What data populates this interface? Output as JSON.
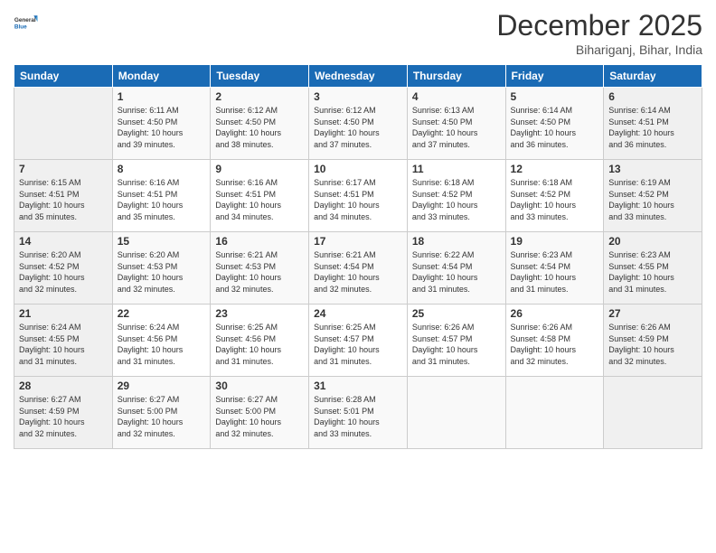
{
  "logo": {
    "line1": "General",
    "line2": "Blue"
  },
  "title": "December 2025",
  "subtitle": "Bihariganj, Bihar, India",
  "weekdays": [
    "Sunday",
    "Monday",
    "Tuesday",
    "Wednesday",
    "Thursday",
    "Friday",
    "Saturday"
  ],
  "weeks": [
    [
      {
        "day": "",
        "info": ""
      },
      {
        "day": "1",
        "info": "Sunrise: 6:11 AM\nSunset: 4:50 PM\nDaylight: 10 hours\nand 39 minutes."
      },
      {
        "day": "2",
        "info": "Sunrise: 6:12 AM\nSunset: 4:50 PM\nDaylight: 10 hours\nand 38 minutes."
      },
      {
        "day": "3",
        "info": "Sunrise: 6:12 AM\nSunset: 4:50 PM\nDaylight: 10 hours\nand 37 minutes."
      },
      {
        "day": "4",
        "info": "Sunrise: 6:13 AM\nSunset: 4:50 PM\nDaylight: 10 hours\nand 37 minutes."
      },
      {
        "day": "5",
        "info": "Sunrise: 6:14 AM\nSunset: 4:50 PM\nDaylight: 10 hours\nand 36 minutes."
      },
      {
        "day": "6",
        "info": "Sunrise: 6:14 AM\nSunset: 4:51 PM\nDaylight: 10 hours\nand 36 minutes."
      }
    ],
    [
      {
        "day": "7",
        "info": "Sunrise: 6:15 AM\nSunset: 4:51 PM\nDaylight: 10 hours\nand 35 minutes."
      },
      {
        "day": "8",
        "info": "Sunrise: 6:16 AM\nSunset: 4:51 PM\nDaylight: 10 hours\nand 35 minutes."
      },
      {
        "day": "9",
        "info": "Sunrise: 6:16 AM\nSunset: 4:51 PM\nDaylight: 10 hours\nand 34 minutes."
      },
      {
        "day": "10",
        "info": "Sunrise: 6:17 AM\nSunset: 4:51 PM\nDaylight: 10 hours\nand 34 minutes."
      },
      {
        "day": "11",
        "info": "Sunrise: 6:18 AM\nSunset: 4:52 PM\nDaylight: 10 hours\nand 33 minutes."
      },
      {
        "day": "12",
        "info": "Sunrise: 6:18 AM\nSunset: 4:52 PM\nDaylight: 10 hours\nand 33 minutes."
      },
      {
        "day": "13",
        "info": "Sunrise: 6:19 AM\nSunset: 4:52 PM\nDaylight: 10 hours\nand 33 minutes."
      }
    ],
    [
      {
        "day": "14",
        "info": "Sunrise: 6:20 AM\nSunset: 4:52 PM\nDaylight: 10 hours\nand 32 minutes."
      },
      {
        "day": "15",
        "info": "Sunrise: 6:20 AM\nSunset: 4:53 PM\nDaylight: 10 hours\nand 32 minutes."
      },
      {
        "day": "16",
        "info": "Sunrise: 6:21 AM\nSunset: 4:53 PM\nDaylight: 10 hours\nand 32 minutes."
      },
      {
        "day": "17",
        "info": "Sunrise: 6:21 AM\nSunset: 4:54 PM\nDaylight: 10 hours\nand 32 minutes."
      },
      {
        "day": "18",
        "info": "Sunrise: 6:22 AM\nSunset: 4:54 PM\nDaylight: 10 hours\nand 31 minutes."
      },
      {
        "day": "19",
        "info": "Sunrise: 6:23 AM\nSunset: 4:54 PM\nDaylight: 10 hours\nand 31 minutes."
      },
      {
        "day": "20",
        "info": "Sunrise: 6:23 AM\nSunset: 4:55 PM\nDaylight: 10 hours\nand 31 minutes."
      }
    ],
    [
      {
        "day": "21",
        "info": "Sunrise: 6:24 AM\nSunset: 4:55 PM\nDaylight: 10 hours\nand 31 minutes."
      },
      {
        "day": "22",
        "info": "Sunrise: 6:24 AM\nSunset: 4:56 PM\nDaylight: 10 hours\nand 31 minutes."
      },
      {
        "day": "23",
        "info": "Sunrise: 6:25 AM\nSunset: 4:56 PM\nDaylight: 10 hours\nand 31 minutes."
      },
      {
        "day": "24",
        "info": "Sunrise: 6:25 AM\nSunset: 4:57 PM\nDaylight: 10 hours\nand 31 minutes."
      },
      {
        "day": "25",
        "info": "Sunrise: 6:26 AM\nSunset: 4:57 PM\nDaylight: 10 hours\nand 31 minutes."
      },
      {
        "day": "26",
        "info": "Sunrise: 6:26 AM\nSunset: 4:58 PM\nDaylight: 10 hours\nand 32 minutes."
      },
      {
        "day": "27",
        "info": "Sunrise: 6:26 AM\nSunset: 4:59 PM\nDaylight: 10 hours\nand 32 minutes."
      }
    ],
    [
      {
        "day": "28",
        "info": "Sunrise: 6:27 AM\nSunset: 4:59 PM\nDaylight: 10 hours\nand 32 minutes."
      },
      {
        "day": "29",
        "info": "Sunrise: 6:27 AM\nSunset: 5:00 PM\nDaylight: 10 hours\nand 32 minutes."
      },
      {
        "day": "30",
        "info": "Sunrise: 6:27 AM\nSunset: 5:00 PM\nDaylight: 10 hours\nand 32 minutes."
      },
      {
        "day": "31",
        "info": "Sunrise: 6:28 AM\nSunset: 5:01 PM\nDaylight: 10 hours\nand 33 minutes."
      },
      {
        "day": "",
        "info": ""
      },
      {
        "day": "",
        "info": ""
      },
      {
        "day": "",
        "info": ""
      }
    ]
  ]
}
